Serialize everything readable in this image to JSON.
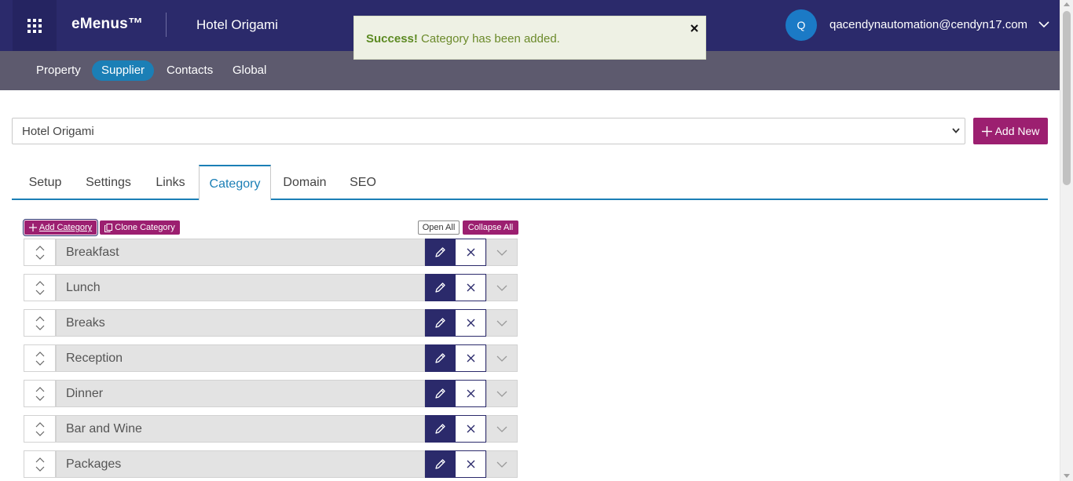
{
  "header": {
    "brand": "eMenus™",
    "hotel_name": "Hotel Origami",
    "user_initial": "Q",
    "user_email": "qacendynautomation@cendyn17.com"
  },
  "toast": {
    "title": "Success!",
    "message": "Category has been added."
  },
  "nav": {
    "items": [
      {
        "label": "Property"
      },
      {
        "label": "Supplier"
      },
      {
        "label": "Contacts"
      },
      {
        "label": "Global"
      }
    ],
    "active": "Supplier"
  },
  "property_select": {
    "value": "Hotel Origami"
  },
  "add_new_label": "Add New",
  "tabs": {
    "items": [
      {
        "label": "Setup"
      },
      {
        "label": "Settings"
      },
      {
        "label": "Links"
      },
      {
        "label": "Category"
      },
      {
        "label": "Domain"
      },
      {
        "label": "SEO"
      }
    ],
    "active": "Category"
  },
  "category_toolbar": {
    "add_category": "Add Category",
    "clone_category": "Clone Category",
    "open_all": "Open All",
    "collapse_all": "Collapse All"
  },
  "categories": [
    {
      "name": "Breakfast"
    },
    {
      "name": "Lunch"
    },
    {
      "name": "Breaks"
    },
    {
      "name": "Reception"
    },
    {
      "name": "Dinner"
    },
    {
      "name": "Bar and Wine"
    },
    {
      "name": "Packages"
    }
  ],
  "colors": {
    "topbar": "#2b2a6b",
    "navbar": "#5d5a6e",
    "accent_blue": "#1b7fb6",
    "accent_magenta": "#9c1f70",
    "success_text": "#5c8a22"
  },
  "icons": {
    "apps": "grid-icon",
    "user_menu": "chevron-down-icon",
    "toast_close": "close-icon",
    "sort": "sort-icon",
    "edit": "pencil-icon",
    "delete": "close-icon",
    "expand": "chevron-down-icon",
    "clone": "copy-icon",
    "add": "plus-icon"
  }
}
